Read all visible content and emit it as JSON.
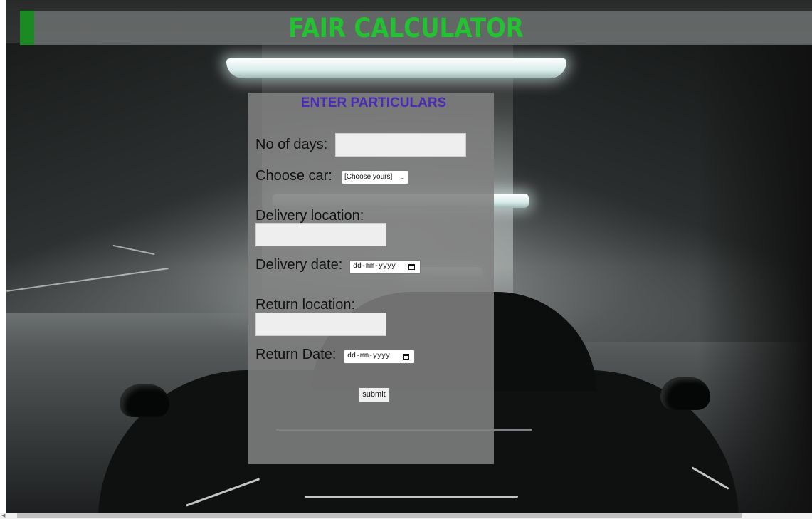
{
  "header": {
    "title": "FAIR CALCULATOR",
    "title_color": "#22c232",
    "accent_color": "#1c8a22"
  },
  "form": {
    "heading": "ENTER PARTICULARS",
    "heading_color": "#4b2bb8",
    "days_label": "No of days:",
    "days_value": "",
    "car_label": "Choose car:",
    "car_selected": "[Choose yours]",
    "delivery_location_label": "Delivery location:",
    "delivery_location_value": "",
    "delivery_date_label": "Delivery date:",
    "delivery_date_placeholder": "dd-mm-yyyy",
    "return_location_label": "Return location:",
    "return_location_value": "",
    "return_date_label": "Return Date:",
    "return_date_placeholder": "dd-mm-yyyy",
    "submit_label": "submit"
  },
  "icons": {
    "select_chevron": "chevron-down-icon",
    "date_picker": "calendar-icon",
    "scroll_left": "scroll-left-arrow-icon"
  }
}
